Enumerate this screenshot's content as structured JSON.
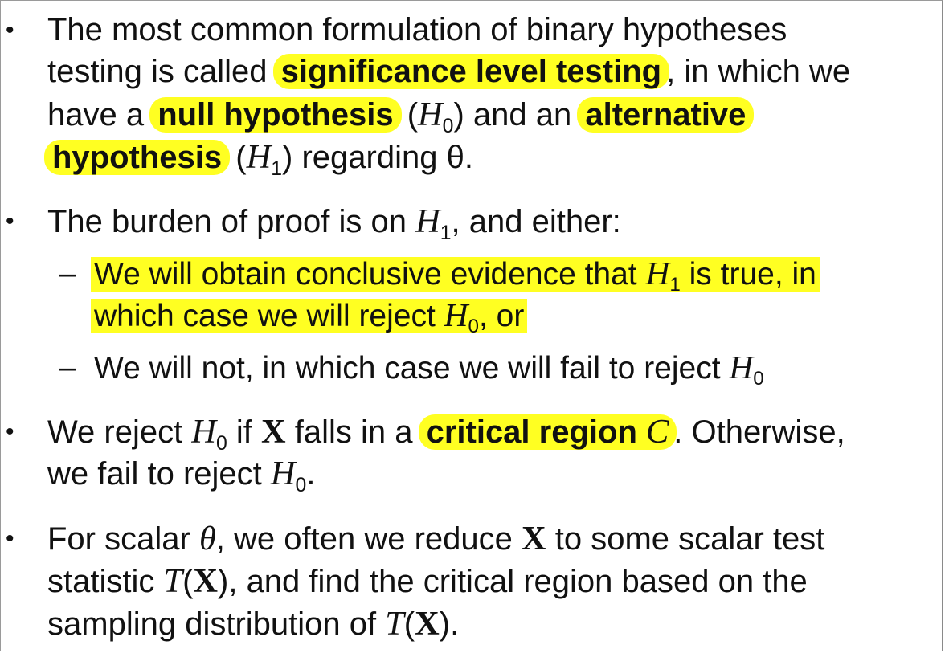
{
  "bullets": [
    {
      "parts": {
        "t1": "The most common formulation of binary hypotheses",
        "t2": "testing is called ",
        "h1": "significance level testing",
        "t3": ", in which we",
        "t4": "have a ",
        "h2": "null hypothesis",
        "t5": " (",
        "m1": "H",
        "s1": "0",
        "t6": ") and an ",
        "h3a": "alternative",
        "h3b": "hypothesis",
        "t7": " (",
        "m2": "H",
        "s2": "1",
        "t8": ") regarding θ."
      }
    },
    {
      "parts": {
        "t1": "The burden of proof is on ",
        "m1": "H",
        "s1": "1",
        "t2": ", and either:"
      },
      "subitems": [
        {
          "a": "We will obtain conclusive evidence that ",
          "m1": "H",
          "s1": "1",
          "b": " is true, in",
          "c": "which case we will reject ",
          "m2": "H",
          "s2": "0",
          "d": ", or"
        },
        {
          "a": "We will not, in which case we will fail to reject ",
          "m1": "H",
          "s1": "0"
        }
      ]
    },
    {
      "parts": {
        "t1": "We reject ",
        "m1": "H",
        "s1": "0",
        "t2": " if ",
        "x": "X",
        "t3": " falls in a ",
        "h1": "critical region ",
        "c": "C",
        "t4": ". Otherwise,",
        "t5": "we fail to reject ",
        "m2": "H",
        "s2": "0",
        "t6": "."
      }
    },
    {
      "parts": {
        "t1": "For scalar ",
        "theta": "θ",
        "t2": ", we often we reduce ",
        "x": "X",
        "t3": " to some scalar test",
        "t4": "statistic ",
        "T1": "T",
        "t5": "(",
        "x2": "X",
        "t6": "), and find the critical region based on the",
        "t7": "sampling distribution of ",
        "T2": "T",
        "t8": "(",
        "x3": "X",
        "t9": ")."
      }
    }
  ],
  "markers": {
    "bullet": "•",
    "dash": "–"
  },
  "colors": {
    "highlight": "#ffff22"
  }
}
